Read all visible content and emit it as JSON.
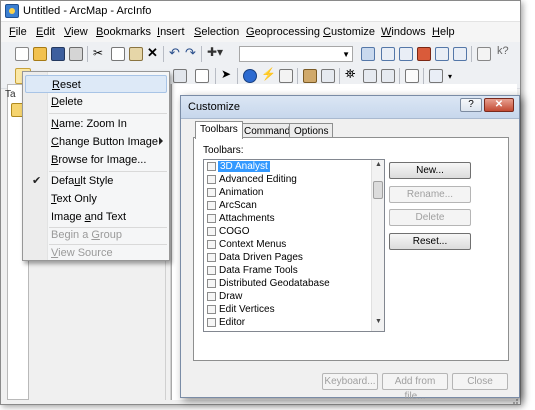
{
  "app": {
    "title": "Untitled - ArcMap - ArcInfo",
    "menus": [
      "File",
      "Edit",
      "View",
      "Bookmarks",
      "Insert",
      "Selection",
      "Geoprocessing",
      "Customize",
      "Windows",
      "Help"
    ],
    "toc_label": "Ta"
  },
  "context_menu": {
    "items": [
      {
        "label": "Reset",
        "underline": "R",
        "rest": "eset",
        "highlighted": true
      },
      {
        "label": "Delete",
        "underline": "D",
        "rest": "elete"
      },
      {
        "label": "Name:  Zoom In",
        "underline": "N",
        "rest": "ame:  Zoom In"
      },
      {
        "label": "Change Button Image",
        "underline": "C",
        "rest": "hange Button Image",
        "submenu": true
      },
      {
        "label": "Browse for Image...",
        "underline": "B",
        "rest": "rowse for Image..."
      },
      {
        "label": "Default Style",
        "checked": true,
        "pre": "Defa",
        "underline": "u",
        "rest": "lt Style"
      },
      {
        "label": "Text Only",
        "underline": "T",
        "rest": "ext Only"
      },
      {
        "label": "Image and Text",
        "pre": "Image ",
        "underline": "a",
        "rest": "nd Text"
      },
      {
        "label": "Begin a Group",
        "disabled": true,
        "underline": "G",
        "pre": "Begin a ",
        "rest": "roup"
      },
      {
        "label": "View Source",
        "disabled": true,
        "underline": "V",
        "rest": "iew Source"
      }
    ]
  },
  "dialog": {
    "title": "Customize",
    "help": "?",
    "close": "✕",
    "tabs": [
      "Toolbars",
      "Commands",
      "Options"
    ],
    "list_label": "Toolbars:",
    "toolbars": [
      "3D Analyst",
      "Advanced Editing",
      "Animation",
      "ArcScan",
      "Attachments",
      "COGO",
      "Context Menus",
      "Data Driven Pages",
      "Data Frame Tools",
      "Distributed Geodatabase",
      "Draw",
      "Edit Vertices",
      "Editor"
    ],
    "selected_index": 0,
    "side_buttons": [
      {
        "label": "New...",
        "enabled": true
      },
      {
        "label": "Rename...",
        "enabled": false
      },
      {
        "label": "Delete",
        "enabled": false
      },
      {
        "label": "Reset...",
        "enabled": true
      }
    ],
    "bottom_buttons": [
      {
        "label": "Keyboard...",
        "enabled": false
      },
      {
        "label": "Add from file...",
        "enabled": false
      },
      {
        "label": "Close",
        "enabled": false
      }
    ]
  },
  "colors": {
    "selection": "#3399ff",
    "menu_highlight": "#dde9f7",
    "close_button": "#c24a33"
  }
}
